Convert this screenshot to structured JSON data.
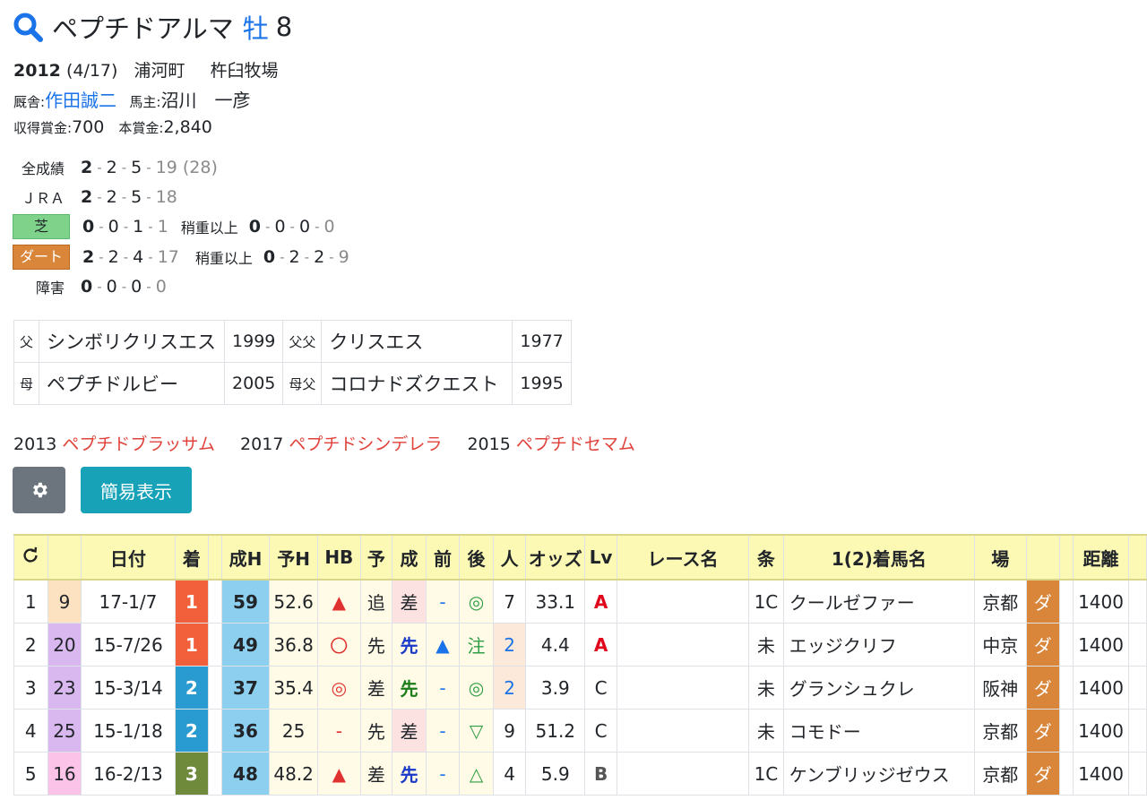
{
  "horse": {
    "name": "ペプチドアルマ",
    "sex": "牡",
    "age": "8"
  },
  "birth": {
    "year": "2012",
    "date": "(4/17)",
    "place": "浦河町",
    "breeder": "杵臼牧場"
  },
  "trainer": {
    "label": "厩舎:",
    "name": "作田誠二",
    "owner_label": "馬主:",
    "owner": "沼川　一彦"
  },
  "prize": {
    "label1": "収得賞金:",
    "value1": "700",
    "label2": "本賞金:",
    "value2": "2,840"
  },
  "records": {
    "all": {
      "label": "全成績",
      "w": "2",
      "s": "2",
      "t": "5",
      "o": "19",
      "total": "(28)"
    },
    "jra": {
      "label": "ＪＲＡ",
      "w": "2",
      "s": "2",
      "t": "5",
      "o": "18"
    },
    "shiba": {
      "label": "芝",
      "w": "0",
      "s": "0",
      "t": "1",
      "o": "1",
      "sub_label": "稍重以上",
      "sw": "0",
      "ss": "0",
      "st": "0",
      "so": "0"
    },
    "dirt": {
      "label": "ダート",
      "w": "2",
      "s": "2",
      "t": "4",
      "o": "17",
      "sub_label": "稍重以上",
      "sw": "0",
      "ss": "2",
      "st": "2",
      "so": "9"
    },
    "obstacle": {
      "label": "障害",
      "w": "0",
      "s": "0",
      "t": "0",
      "o": "0"
    }
  },
  "pedigree": {
    "sire_label": "父",
    "sire": "シンボリクリスエス",
    "sire_year": "1999",
    "ss_label": "父父",
    "ss": "クリスエス",
    "ss_year": "1977",
    "dam_label": "母",
    "dam": "ペプチドルビー",
    "dam_year": "2005",
    "ds_label": "母父",
    "ds": "コロナドズクエスト",
    "ds_year": "1995"
  },
  "progeny": [
    {
      "year": "2013",
      "name": "ペプチドブラッサム"
    },
    {
      "year": "2017",
      "name": "ペプチドシンデレラ"
    },
    {
      "year": "2015",
      "name": "ペプチドセマム"
    }
  ],
  "buttons": {
    "simple": "簡易表示"
  },
  "table": {
    "headers": [
      "",
      "",
      "日付",
      "着",
      "",
      "成H",
      "予H",
      "HB",
      "予",
      "成",
      "前",
      "後",
      "人",
      "オッズ",
      "Lv",
      "レース名",
      "条",
      "1(2)着馬名",
      "場",
      "",
      "",
      "距離",
      ""
    ],
    "rows": [
      {
        "no": "1",
        "num": "9",
        "date": "17-1/7",
        "rank": "1",
        "sh": "59",
        "yh": "52.6",
        "hb": "▲",
        "yo": "追",
        "sei": "差",
        "mae": "-",
        "ato": "◎",
        "nin": "7",
        "odds": "33.1",
        "lv": "A",
        "race": "",
        "jou": "1C",
        "winner": "クールゼファー",
        "ba": "京都",
        "tr": "ダ",
        "dist": "1400"
      },
      {
        "no": "2",
        "num": "20",
        "date": "15-7/26",
        "rank": "1",
        "sh": "49",
        "yh": "36.8",
        "hb": "〇",
        "yo": "先",
        "sei": "先",
        "mae": "▲",
        "ato": "注",
        "nin": "2",
        "odds": "4.4",
        "lv": "A",
        "race": "",
        "jou": "未",
        "winner": "エッジクリフ",
        "ba": "中京",
        "tr": "ダ",
        "dist": "1400"
      },
      {
        "no": "3",
        "num": "23",
        "date": "15-3/14",
        "rank": "2",
        "sh": "37",
        "yh": "35.4",
        "hb": "◎",
        "yo": "差",
        "sei": "先",
        "mae": "-",
        "ato": "◎",
        "nin": "2",
        "odds": "3.9",
        "lv": "C",
        "race": "",
        "jou": "未",
        "winner": "グランシュクレ",
        "ba": "阪神",
        "tr": "ダ",
        "dist": "1400"
      },
      {
        "no": "4",
        "num": "25",
        "date": "15-1/18",
        "rank": "2",
        "sh": "36",
        "yh": "25",
        "hb": "-",
        "yo": "先",
        "sei": "差",
        "mae": "-",
        "ato": "▽",
        "nin": "9",
        "odds": "51.2",
        "lv": "C",
        "race": "",
        "jou": "未",
        "winner": "コモドー",
        "ba": "京都",
        "tr": "ダ",
        "dist": "1400"
      },
      {
        "no": "5",
        "num": "16",
        "date": "16-2/13",
        "rank": "3",
        "sh": "48",
        "yh": "48.2",
        "hb": "▲",
        "yo": "差",
        "sei": "先",
        "mae": "-",
        "ato": "△",
        "nin": "4",
        "odds": "5.9",
        "lv": "B",
        "race": "",
        "jou": "1C",
        "winner": "ケンブリッジゼウス",
        "ba": "京都",
        "tr": "ダ",
        "dist": "1400"
      }
    ]
  },
  "colors": {
    "rank1": "#f2603b",
    "rank2": "#2a9bd0",
    "rank3": "#6f8a3a",
    "num": [
      "#fde2c2",
      "#d9b8f0",
      "#d9b8f0",
      "#d9b8f0",
      "#fbc3e8"
    ],
    "sh": "#8ccfee",
    "dirt": "#d9853a"
  }
}
